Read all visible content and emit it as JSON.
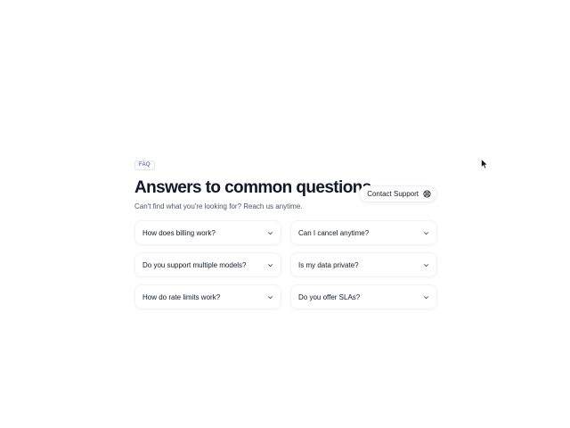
{
  "faq": {
    "badge": "FAQ",
    "title": "Answers to common questions",
    "subtitle": "Can't find what you're looking for? Reach us anytime.",
    "contact_button": {
      "label": "Contact Support",
      "icon": "support-icon"
    },
    "items": [
      {
        "question": "How does billing work?",
        "icon": "chevron-down-icon"
      },
      {
        "question": "Can I cancel anytime?",
        "icon": "chevron-down-icon"
      },
      {
        "question": "Do you support multiple models?",
        "icon": "chevron-down-icon"
      },
      {
        "question": "Is my data private?",
        "icon": "chevron-down-icon"
      },
      {
        "question": "How do rate limits work?",
        "icon": "chevron-down-icon"
      },
      {
        "question": "Do you offer SLAs?",
        "icon": "chevron-down-icon"
      }
    ]
  },
  "colors": {
    "text": "#111827",
    "muted": "#4b5563",
    "badge_text": "#3f3f8f",
    "border": "#f1f3f5"
  }
}
